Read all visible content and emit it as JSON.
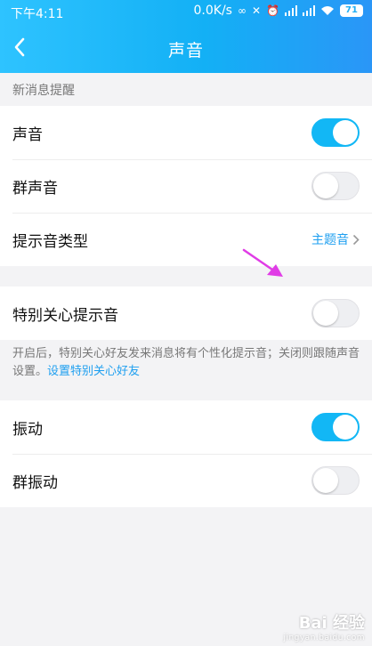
{
  "status_bar": {
    "time": "下午4:11",
    "net_speed": "0.0K/s",
    "battery": "71",
    "icons": [
      "link-icon",
      "mute-icon",
      "alarm-icon",
      "signal-icon",
      "signal-icon",
      "wifi-icon",
      "battery-icon"
    ]
  },
  "header": {
    "title": "声音",
    "back_icon": "chevron-left-icon",
    "colors": {
      "start": "#2ec3ff",
      "end": "#2a96f7"
    }
  },
  "section_caption": "新消息提醒",
  "sound_group": {
    "rows": [
      {
        "label": "声音",
        "toggle_on": true
      },
      {
        "label": "群声音",
        "toggle_on": false
      },
      {
        "label": "提示音类型",
        "value": "主题音"
      }
    ]
  },
  "special_group": {
    "label": "特别关心提示音",
    "toggle_on": false,
    "hint_text": "开启后，特别关心好友发来消息将有个性化提示音；关闭则跟随声音设置。",
    "hint_link": "设置特别关心好友"
  },
  "vibration_group": {
    "rows": [
      {
        "label": "振动",
        "toggle_on": true
      },
      {
        "label": "群振动",
        "toggle_on": false
      }
    ]
  },
  "colors": {
    "accent": "#12b7f5",
    "toggle_off": "#eeeff2",
    "annotation_arrow": "#e03ce6"
  },
  "watermark": {
    "text": "Bai 经验",
    "sub": "jingyan.baidu.com"
  }
}
